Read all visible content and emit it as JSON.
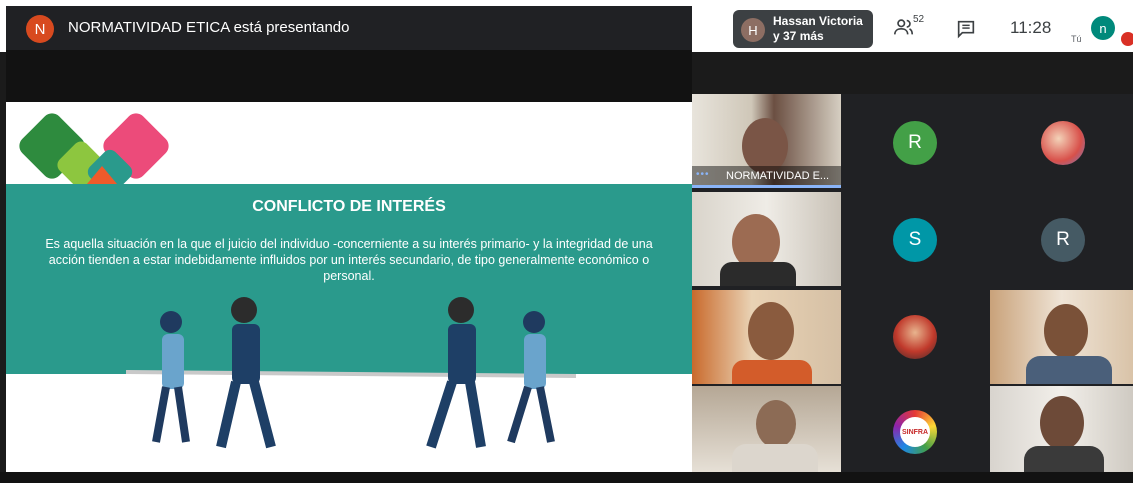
{
  "presenter": {
    "avatar_letter": "N",
    "label": "NORMATIVIDAD ETICA está presentando"
  },
  "participants_chip": {
    "avatar_letter": "H",
    "line1": "Hassan Victoria",
    "line2": "y 37 más"
  },
  "people_count": "52",
  "clock": "11:28",
  "self": {
    "label": "Tú",
    "avatar_letter": "n"
  },
  "slide": {
    "title": "CONFLICTO DE INTERÉS",
    "body": "Es aquella situación en la que el juicio del individuo -concerniente a su interés primario- y la integridad de una acción tienden a estar indebidamente influidos por un interés secundario, de tipo generalmente económico o personal."
  },
  "tiles": {
    "main_name": "NORMATIVIDAD E...",
    "avatar_r1": "R",
    "avatar_s": "S",
    "avatar_r2": "R",
    "logo_text": "SINFRA"
  },
  "colors": {
    "presenter_avatar": "#d84a1f",
    "slide_band": "#2a9a8c",
    "avatar_r1": "#43a047",
    "avatar_s": "#0097a7",
    "avatar_r2": "#455a64",
    "self_avatar": "#00897b"
  }
}
